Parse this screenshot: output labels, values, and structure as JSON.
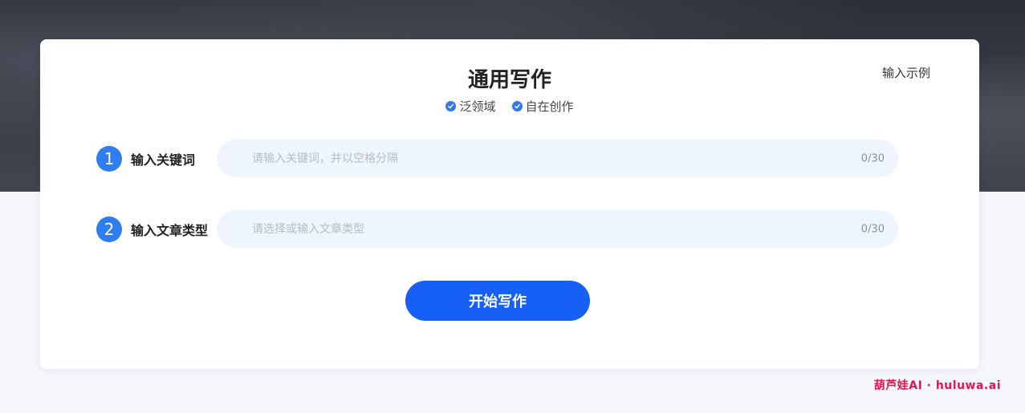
{
  "header": {
    "title": "通用写作",
    "example_link": "输入示例",
    "tags": [
      "泛领域",
      "自在创作"
    ]
  },
  "form": {
    "fields": [
      {
        "step": "1",
        "label": "输入关键词",
        "placeholder": "请输入关键词，并以空格分隔",
        "value": "",
        "counter": "0/30"
      },
      {
        "step": "2",
        "label": "输入文章类型",
        "placeholder": "请选择或输入文章类型",
        "value": "",
        "counter": "0/30"
      }
    ],
    "submit_label": "开始写作"
  },
  "watermark": "葫芦娃AI · huluwa.ai",
  "colors": {
    "accent": "#1660f5",
    "step_badge": "#2f7ef0",
    "field_bg": "#eff5fd",
    "watermark": "#e5164f"
  }
}
